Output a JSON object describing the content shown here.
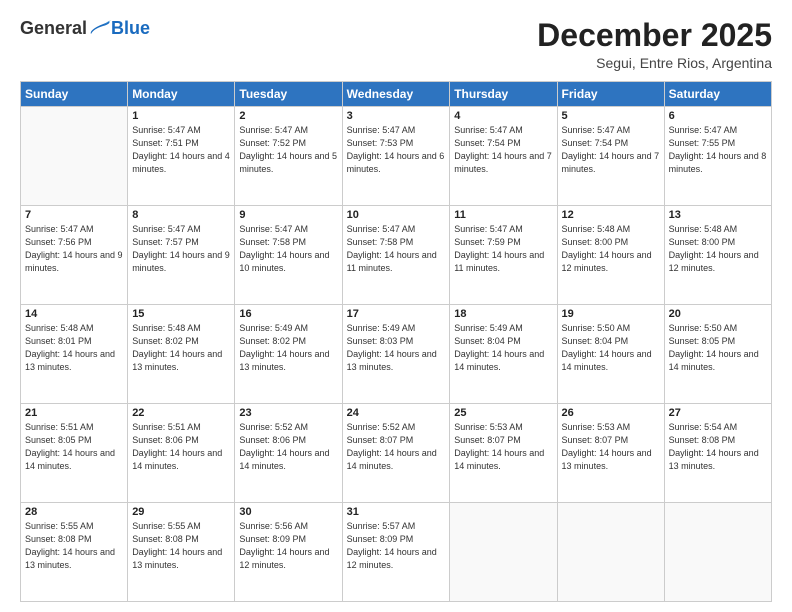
{
  "header": {
    "logo": {
      "general": "General",
      "blue": "Blue"
    },
    "title": "December 2025",
    "subtitle": "Segui, Entre Rios, Argentina"
  },
  "weekdays": [
    "Sunday",
    "Monday",
    "Tuesday",
    "Wednesday",
    "Thursday",
    "Friday",
    "Saturday"
  ],
  "weeks": [
    [
      {
        "num": "",
        "sunrise": "",
        "sunset": "",
        "daylight": ""
      },
      {
        "num": "1",
        "sunrise": "Sunrise: 5:47 AM",
        "sunset": "Sunset: 7:51 PM",
        "daylight": "Daylight: 14 hours and 4 minutes."
      },
      {
        "num": "2",
        "sunrise": "Sunrise: 5:47 AM",
        "sunset": "Sunset: 7:52 PM",
        "daylight": "Daylight: 14 hours and 5 minutes."
      },
      {
        "num": "3",
        "sunrise": "Sunrise: 5:47 AM",
        "sunset": "Sunset: 7:53 PM",
        "daylight": "Daylight: 14 hours and 6 minutes."
      },
      {
        "num": "4",
        "sunrise": "Sunrise: 5:47 AM",
        "sunset": "Sunset: 7:54 PM",
        "daylight": "Daylight: 14 hours and 7 minutes."
      },
      {
        "num": "5",
        "sunrise": "Sunrise: 5:47 AM",
        "sunset": "Sunset: 7:54 PM",
        "daylight": "Daylight: 14 hours and 7 minutes."
      },
      {
        "num": "6",
        "sunrise": "Sunrise: 5:47 AM",
        "sunset": "Sunset: 7:55 PM",
        "daylight": "Daylight: 14 hours and 8 minutes."
      }
    ],
    [
      {
        "num": "7",
        "sunrise": "Sunrise: 5:47 AM",
        "sunset": "Sunset: 7:56 PM",
        "daylight": "Daylight: 14 hours and 9 minutes."
      },
      {
        "num": "8",
        "sunrise": "Sunrise: 5:47 AM",
        "sunset": "Sunset: 7:57 PM",
        "daylight": "Daylight: 14 hours and 9 minutes."
      },
      {
        "num": "9",
        "sunrise": "Sunrise: 5:47 AM",
        "sunset": "Sunset: 7:58 PM",
        "daylight": "Daylight: 14 hours and 10 minutes."
      },
      {
        "num": "10",
        "sunrise": "Sunrise: 5:47 AM",
        "sunset": "Sunset: 7:58 PM",
        "daylight": "Daylight: 14 hours and 11 minutes."
      },
      {
        "num": "11",
        "sunrise": "Sunrise: 5:47 AM",
        "sunset": "Sunset: 7:59 PM",
        "daylight": "Daylight: 14 hours and 11 minutes."
      },
      {
        "num": "12",
        "sunrise": "Sunrise: 5:48 AM",
        "sunset": "Sunset: 8:00 PM",
        "daylight": "Daylight: 14 hours and 12 minutes."
      },
      {
        "num": "13",
        "sunrise": "Sunrise: 5:48 AM",
        "sunset": "Sunset: 8:00 PM",
        "daylight": "Daylight: 14 hours and 12 minutes."
      }
    ],
    [
      {
        "num": "14",
        "sunrise": "Sunrise: 5:48 AM",
        "sunset": "Sunset: 8:01 PM",
        "daylight": "Daylight: 14 hours and 13 minutes."
      },
      {
        "num": "15",
        "sunrise": "Sunrise: 5:48 AM",
        "sunset": "Sunset: 8:02 PM",
        "daylight": "Daylight: 14 hours and 13 minutes."
      },
      {
        "num": "16",
        "sunrise": "Sunrise: 5:49 AM",
        "sunset": "Sunset: 8:02 PM",
        "daylight": "Daylight: 14 hours and 13 minutes."
      },
      {
        "num": "17",
        "sunrise": "Sunrise: 5:49 AM",
        "sunset": "Sunset: 8:03 PM",
        "daylight": "Daylight: 14 hours and 13 minutes."
      },
      {
        "num": "18",
        "sunrise": "Sunrise: 5:49 AM",
        "sunset": "Sunset: 8:04 PM",
        "daylight": "Daylight: 14 hours and 14 minutes."
      },
      {
        "num": "19",
        "sunrise": "Sunrise: 5:50 AM",
        "sunset": "Sunset: 8:04 PM",
        "daylight": "Daylight: 14 hours and 14 minutes."
      },
      {
        "num": "20",
        "sunrise": "Sunrise: 5:50 AM",
        "sunset": "Sunset: 8:05 PM",
        "daylight": "Daylight: 14 hours and 14 minutes."
      }
    ],
    [
      {
        "num": "21",
        "sunrise": "Sunrise: 5:51 AM",
        "sunset": "Sunset: 8:05 PM",
        "daylight": "Daylight: 14 hours and 14 minutes."
      },
      {
        "num": "22",
        "sunrise": "Sunrise: 5:51 AM",
        "sunset": "Sunset: 8:06 PM",
        "daylight": "Daylight: 14 hours and 14 minutes."
      },
      {
        "num": "23",
        "sunrise": "Sunrise: 5:52 AM",
        "sunset": "Sunset: 8:06 PM",
        "daylight": "Daylight: 14 hours and 14 minutes."
      },
      {
        "num": "24",
        "sunrise": "Sunrise: 5:52 AM",
        "sunset": "Sunset: 8:07 PM",
        "daylight": "Daylight: 14 hours and 14 minutes."
      },
      {
        "num": "25",
        "sunrise": "Sunrise: 5:53 AM",
        "sunset": "Sunset: 8:07 PM",
        "daylight": "Daylight: 14 hours and 14 minutes."
      },
      {
        "num": "26",
        "sunrise": "Sunrise: 5:53 AM",
        "sunset": "Sunset: 8:07 PM",
        "daylight": "Daylight: 14 hours and 13 minutes."
      },
      {
        "num": "27",
        "sunrise": "Sunrise: 5:54 AM",
        "sunset": "Sunset: 8:08 PM",
        "daylight": "Daylight: 14 hours and 13 minutes."
      }
    ],
    [
      {
        "num": "28",
        "sunrise": "Sunrise: 5:55 AM",
        "sunset": "Sunset: 8:08 PM",
        "daylight": "Daylight: 14 hours and 13 minutes."
      },
      {
        "num": "29",
        "sunrise": "Sunrise: 5:55 AM",
        "sunset": "Sunset: 8:08 PM",
        "daylight": "Daylight: 14 hours and 13 minutes."
      },
      {
        "num": "30",
        "sunrise": "Sunrise: 5:56 AM",
        "sunset": "Sunset: 8:09 PM",
        "daylight": "Daylight: 14 hours and 12 minutes."
      },
      {
        "num": "31",
        "sunrise": "Sunrise: 5:57 AM",
        "sunset": "Sunset: 8:09 PM",
        "daylight": "Daylight: 14 hours and 12 minutes."
      },
      {
        "num": "",
        "sunrise": "",
        "sunset": "",
        "daylight": ""
      },
      {
        "num": "",
        "sunrise": "",
        "sunset": "",
        "daylight": ""
      },
      {
        "num": "",
        "sunrise": "",
        "sunset": "",
        "daylight": ""
      }
    ]
  ]
}
